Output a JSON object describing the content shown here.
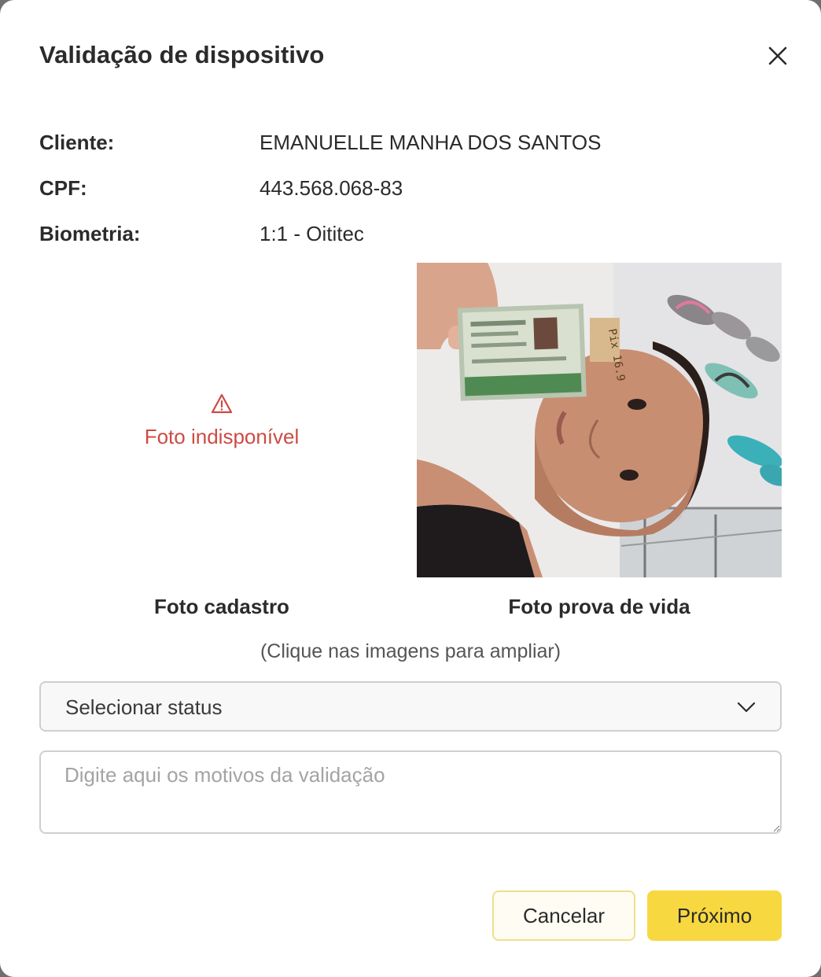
{
  "modal": {
    "title": "Validação de dispositivo"
  },
  "info": [
    {
      "label": "Cliente:",
      "value": "EMANUELLE MANHA DOS SANTOS"
    },
    {
      "label": "CPF:",
      "value": "443.568.068-83"
    },
    {
      "label": "Biometria:",
      "value": "1:1 - Oititec"
    }
  ],
  "photos": {
    "missing_text": "Foto indisponível",
    "caption_register": "Foto cadastro",
    "caption_liveness": "Foto prova de vida",
    "hint": "(Clique nas imagens para ampliar)"
  },
  "form": {
    "status_placeholder": "Selecionar status",
    "reason_placeholder": "Digite aqui os motivos da validação"
  },
  "actions": {
    "cancel": "Cancelar",
    "next": "Próximo"
  },
  "colors": {
    "error": "#cc4b43",
    "primary": "#f7d840",
    "secondary_border": "#efdf8a"
  }
}
